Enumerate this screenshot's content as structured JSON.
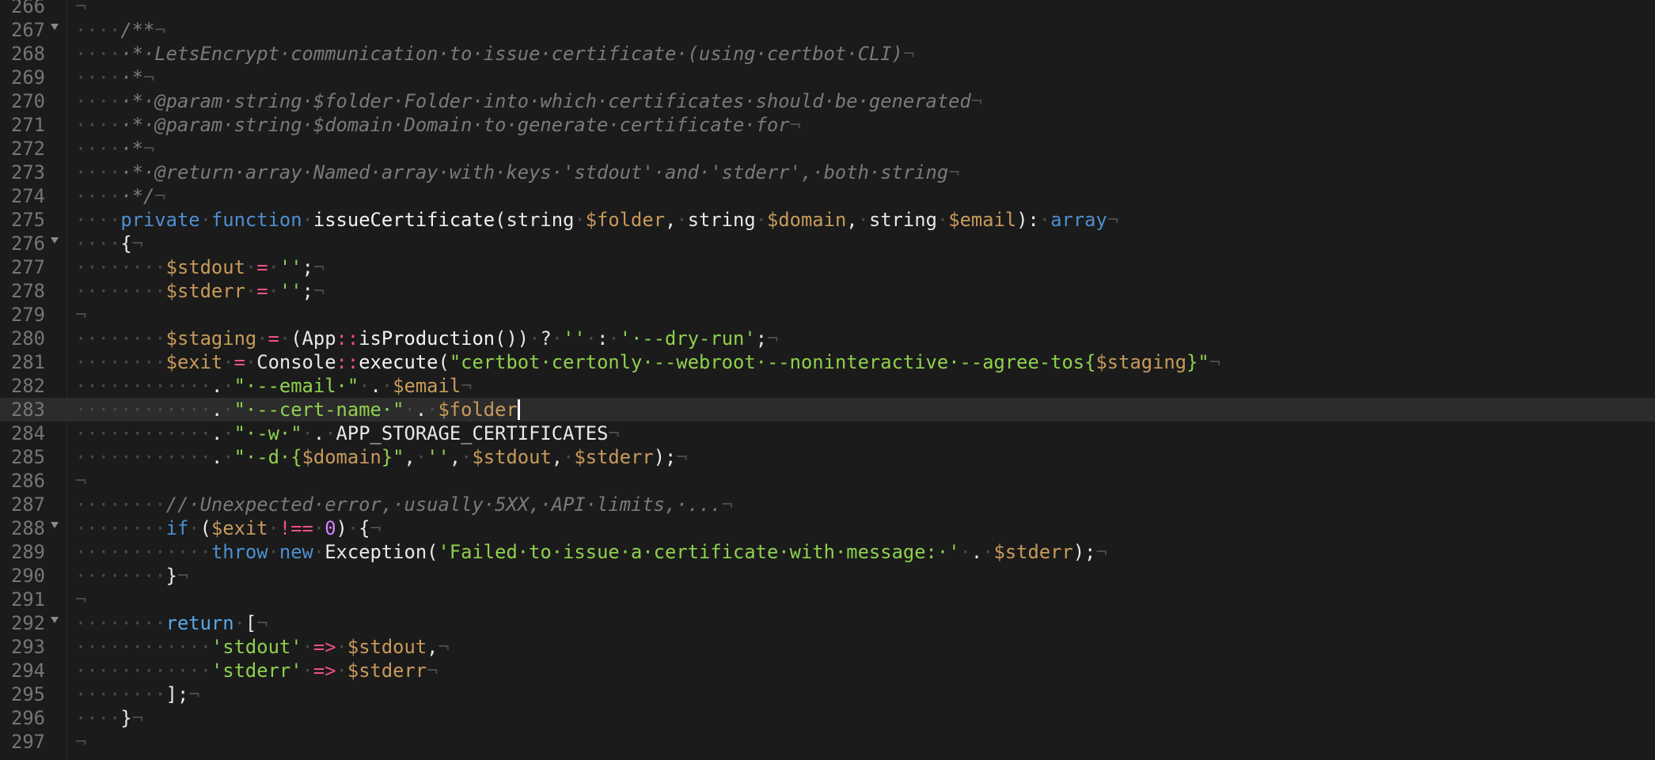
{
  "editor": {
    "theme_colors": {
      "background": "#1b1b1b",
      "current_line": "#2c2c2c",
      "comment": "#7a7a7a",
      "keyword": "#4d8fd1",
      "variable": "#c89a5a",
      "operator": "#f0508c",
      "string": "#8fd14d",
      "number": "#d580ff"
    },
    "current_line": 283,
    "lines": [
      {
        "n": "266",
        "fold": false,
        "tokens": [
          [
            "eol",
            "¬"
          ]
        ]
      },
      {
        "n": "267",
        "fold": true,
        "tokens": [
          [
            "ws",
            "····"
          ],
          [
            "cm",
            "/**"
          ],
          [
            "eol",
            "¬"
          ]
        ]
      },
      {
        "n": "268",
        "fold": false,
        "tokens": [
          [
            "ws",
            "····"
          ],
          [
            "cm",
            "·*·LetsEncrypt·communication·to·issue·certificate·(using·certbot·CLI)"
          ],
          [
            "eol",
            "¬"
          ]
        ]
      },
      {
        "n": "269",
        "fold": false,
        "tokens": [
          [
            "ws",
            "····"
          ],
          [
            "cm",
            "·*"
          ],
          [
            "eol",
            "¬"
          ]
        ]
      },
      {
        "n": "270",
        "fold": false,
        "tokens": [
          [
            "ws",
            "····"
          ],
          [
            "cm",
            "·*·@param·string·$folder·Folder·into·which·certificates·should·be·generated"
          ],
          [
            "eol",
            "¬"
          ]
        ]
      },
      {
        "n": "271",
        "fold": false,
        "tokens": [
          [
            "ws",
            "····"
          ],
          [
            "cm",
            "·*·@param·string·$domain·Domain·to·generate·certificate·for"
          ],
          [
            "eol",
            "¬"
          ]
        ]
      },
      {
        "n": "272",
        "fold": false,
        "tokens": [
          [
            "ws",
            "····"
          ],
          [
            "cm",
            "·*"
          ],
          [
            "eol",
            "¬"
          ]
        ]
      },
      {
        "n": "273",
        "fold": false,
        "tokens": [
          [
            "ws",
            "····"
          ],
          [
            "cm",
            "·*·@return·array·Named·array·with·keys·'stdout'·and·'stderr',·both·string"
          ],
          [
            "eol",
            "¬"
          ]
        ]
      },
      {
        "n": "274",
        "fold": false,
        "tokens": [
          [
            "ws",
            "····"
          ],
          [
            "cm",
            "·*/"
          ],
          [
            "eol",
            "¬"
          ]
        ]
      },
      {
        "n": "275",
        "fold": false,
        "tokens": [
          [
            "ws",
            "····"
          ],
          [
            "kw",
            "private"
          ],
          [
            "ws",
            "·"
          ],
          [
            "kw",
            "function"
          ],
          [
            "ws",
            "·"
          ],
          [
            "fn",
            "issueCertificate"
          ],
          [
            "pl",
            "(string"
          ],
          [
            "ws",
            "·"
          ],
          [
            "var",
            "$folder"
          ],
          [
            "pl",
            ","
          ],
          [
            "ws",
            "·"
          ],
          [
            "pl",
            "string"
          ],
          [
            "ws",
            "·"
          ],
          [
            "var",
            "$domain"
          ],
          [
            "pl",
            ","
          ],
          [
            "ws",
            "·"
          ],
          [
            "pl",
            "string"
          ],
          [
            "ws",
            "·"
          ],
          [
            "var",
            "$email"
          ],
          [
            "pl",
            "):"
          ],
          [
            "ws",
            "·"
          ],
          [
            "kw",
            "array"
          ],
          [
            "eol",
            "¬"
          ]
        ]
      },
      {
        "n": "276",
        "fold": true,
        "tokens": [
          [
            "ws",
            "····"
          ],
          [
            "pl",
            "{"
          ],
          [
            "eol",
            "¬"
          ]
        ]
      },
      {
        "n": "277",
        "fold": false,
        "tokens": [
          [
            "ws",
            "········"
          ],
          [
            "var",
            "$stdout"
          ],
          [
            "ws",
            "·"
          ],
          [
            "op",
            "="
          ],
          [
            "ws",
            "·"
          ],
          [
            "str",
            "''"
          ],
          [
            "pl",
            ";"
          ],
          [
            "eol",
            "¬"
          ]
        ]
      },
      {
        "n": "278",
        "fold": false,
        "tokens": [
          [
            "ws",
            "········"
          ],
          [
            "var",
            "$stderr"
          ],
          [
            "ws",
            "·"
          ],
          [
            "op",
            "="
          ],
          [
            "ws",
            "·"
          ],
          [
            "str",
            "''"
          ],
          [
            "pl",
            ";"
          ],
          [
            "eol",
            "¬"
          ]
        ]
      },
      {
        "n": "279",
        "fold": false,
        "tokens": [
          [
            "eol",
            "¬"
          ]
        ]
      },
      {
        "n": "280",
        "fold": false,
        "tokens": [
          [
            "ws",
            "········"
          ],
          [
            "var",
            "$staging"
          ],
          [
            "ws",
            "·"
          ],
          [
            "op",
            "="
          ],
          [
            "ws",
            "·"
          ],
          [
            "pl",
            "(App"
          ],
          [
            "op",
            "::"
          ],
          [
            "fn",
            "isProduction"
          ],
          [
            "pl",
            "())"
          ],
          [
            "ws",
            "·"
          ],
          [
            "pl",
            "?"
          ],
          [
            "ws",
            "·"
          ],
          [
            "str",
            "''"
          ],
          [
            "ws",
            "·"
          ],
          [
            "pl",
            ":"
          ],
          [
            "ws",
            "·"
          ],
          [
            "str",
            "'·--dry-run'"
          ],
          [
            "pl",
            ";"
          ],
          [
            "eol",
            "¬"
          ]
        ]
      },
      {
        "n": "281",
        "fold": false,
        "tokens": [
          [
            "ws",
            "········"
          ],
          [
            "var",
            "$exit"
          ],
          [
            "ws",
            "·"
          ],
          [
            "op",
            "="
          ],
          [
            "ws",
            "·"
          ],
          [
            "cls",
            "Console"
          ],
          [
            "op",
            "::"
          ],
          [
            "fn",
            "execute"
          ],
          [
            "pl",
            "("
          ],
          [
            "str",
            "\"certbot·certonly·--webroot·--noninteractive·--agree-tos{"
          ],
          [
            "var",
            "$staging"
          ],
          [
            "str",
            "}\""
          ],
          [
            "eol",
            "¬"
          ]
        ]
      },
      {
        "n": "282",
        "fold": false,
        "tokens": [
          [
            "ws",
            "············"
          ],
          [
            "pl",
            "."
          ],
          [
            "ws",
            "·"
          ],
          [
            "str",
            "\"·--email·\""
          ],
          [
            "ws",
            "·"
          ],
          [
            "pl",
            "."
          ],
          [
            "ws",
            "·"
          ],
          [
            "var",
            "$email"
          ],
          [
            "eol",
            "¬"
          ]
        ]
      },
      {
        "n": "283",
        "fold": false,
        "cursor": true,
        "tokens": [
          [
            "ws",
            "············"
          ],
          [
            "pl",
            "."
          ],
          [
            "ws",
            "·"
          ],
          [
            "str",
            "\"·--cert-name·\""
          ],
          [
            "ws",
            "·"
          ],
          [
            "pl",
            "."
          ],
          [
            "ws",
            "·"
          ],
          [
            "var",
            "$folder"
          ]
        ]
      },
      {
        "n": "284",
        "fold": false,
        "tokens": [
          [
            "ws",
            "············"
          ],
          [
            "pl",
            "."
          ],
          [
            "ws",
            "·"
          ],
          [
            "str",
            "\"·-w·\""
          ],
          [
            "ws",
            "·"
          ],
          [
            "pl",
            "."
          ],
          [
            "ws",
            "·"
          ],
          [
            "pl",
            "APP_STORAGE_CERTIFICATES"
          ],
          [
            "eol",
            "¬"
          ]
        ]
      },
      {
        "n": "285",
        "fold": false,
        "tokens": [
          [
            "ws",
            "············"
          ],
          [
            "pl",
            "."
          ],
          [
            "ws",
            "·"
          ],
          [
            "str",
            "\"·-d·{"
          ],
          [
            "var",
            "$domain"
          ],
          [
            "str",
            "}\""
          ],
          [
            "pl",
            ","
          ],
          [
            "ws",
            "·"
          ],
          [
            "str",
            "''"
          ],
          [
            "pl",
            ","
          ],
          [
            "ws",
            "·"
          ],
          [
            "var",
            "$stdout"
          ],
          [
            "pl",
            ","
          ],
          [
            "ws",
            "·"
          ],
          [
            "var",
            "$stderr"
          ],
          [
            "pl",
            ");"
          ],
          [
            "eol",
            "¬"
          ]
        ]
      },
      {
        "n": "286",
        "fold": false,
        "tokens": [
          [
            "eol",
            "¬"
          ]
        ]
      },
      {
        "n": "287",
        "fold": false,
        "tokens": [
          [
            "ws",
            "········"
          ],
          [
            "cm",
            "//·Unexpected·error,·usually·5XX,·API·limits,·..."
          ],
          [
            "eol",
            "¬"
          ]
        ]
      },
      {
        "n": "288",
        "fold": true,
        "tokens": [
          [
            "ws",
            "········"
          ],
          [
            "kw",
            "if"
          ],
          [
            "ws",
            "·"
          ],
          [
            "pl",
            "("
          ],
          [
            "var",
            "$exit"
          ],
          [
            "ws",
            "·"
          ],
          [
            "op",
            "!=="
          ],
          [
            "ws",
            "·"
          ],
          [
            "num",
            "0"
          ],
          [
            "pl",
            ")"
          ],
          [
            "ws",
            "·"
          ],
          [
            "pl",
            "{"
          ],
          [
            "eol",
            "¬"
          ]
        ]
      },
      {
        "n": "289",
        "fold": false,
        "tokens": [
          [
            "ws",
            "············"
          ],
          [
            "kw",
            "throw"
          ],
          [
            "ws",
            "·"
          ],
          [
            "kw",
            "new"
          ],
          [
            "ws",
            "·"
          ],
          [
            "cls",
            "Exception"
          ],
          [
            "pl",
            "("
          ],
          [
            "str",
            "'Failed·to·issue·a·certificate·with·message:·'"
          ],
          [
            "ws",
            "·"
          ],
          [
            "pl",
            "."
          ],
          [
            "ws",
            "·"
          ],
          [
            "var",
            "$stderr"
          ],
          [
            "pl",
            ");"
          ],
          [
            "eol",
            "¬"
          ]
        ]
      },
      {
        "n": "290",
        "fold": false,
        "tokens": [
          [
            "ws",
            "········"
          ],
          [
            "pl",
            "}"
          ],
          [
            "eol",
            "¬"
          ]
        ]
      },
      {
        "n": "291",
        "fold": false,
        "tokens": [
          [
            "eol",
            "¬"
          ]
        ]
      },
      {
        "n": "292",
        "fold": true,
        "tokens": [
          [
            "ws",
            "········"
          ],
          [
            "kw2",
            "return"
          ],
          [
            "ws",
            "·"
          ],
          [
            "pl",
            "["
          ],
          [
            "eol",
            "¬"
          ]
        ]
      },
      {
        "n": "293",
        "fold": false,
        "tokens": [
          [
            "ws",
            "············"
          ],
          [
            "str",
            "'stdout'"
          ],
          [
            "ws",
            "·"
          ],
          [
            "op",
            "=>"
          ],
          [
            "ws",
            "·"
          ],
          [
            "var",
            "$stdout"
          ],
          [
            "pl",
            ","
          ],
          [
            "eol",
            "¬"
          ]
        ]
      },
      {
        "n": "294",
        "fold": false,
        "tokens": [
          [
            "ws",
            "············"
          ],
          [
            "str",
            "'stderr'"
          ],
          [
            "ws",
            "·"
          ],
          [
            "op",
            "=>"
          ],
          [
            "ws",
            "·"
          ],
          [
            "var",
            "$stderr"
          ],
          [
            "eol",
            "¬"
          ]
        ]
      },
      {
        "n": "295",
        "fold": false,
        "tokens": [
          [
            "ws",
            "········"
          ],
          [
            "pl",
            "];"
          ],
          [
            "eol",
            "¬"
          ]
        ]
      },
      {
        "n": "296",
        "fold": false,
        "tokens": [
          [
            "ws",
            "····"
          ],
          [
            "pl",
            "}"
          ],
          [
            "eol",
            "¬"
          ]
        ]
      },
      {
        "n": "297",
        "fold": false,
        "tokens": [
          [
            "eol",
            "¬"
          ]
        ]
      }
    ]
  }
}
